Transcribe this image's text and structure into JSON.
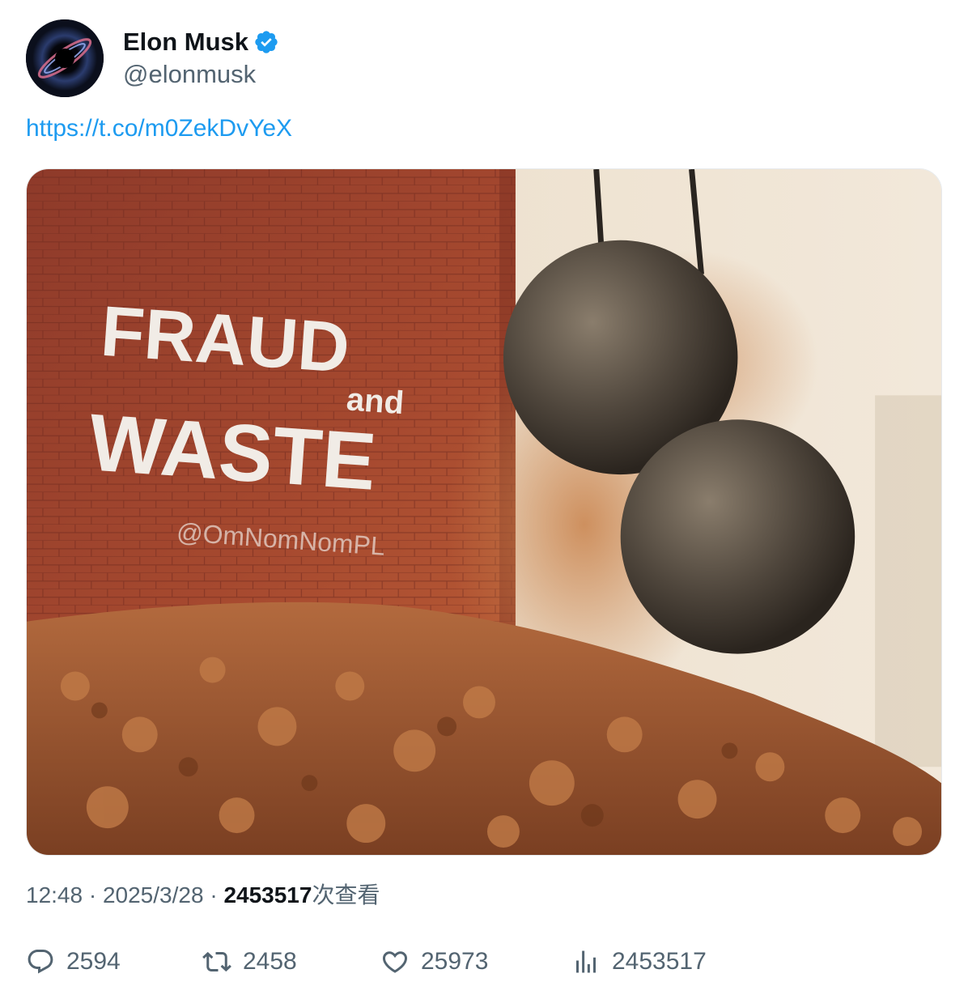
{
  "author": {
    "display_name": "Elon Musk",
    "handle": "@elonmusk",
    "verified": true,
    "avatar_icon": "black-hole-avatar",
    "verified_color": "#1d9bf0"
  },
  "tweet": {
    "link_text": "https://t.co/m0ZekDvYeX",
    "image": {
      "wall_text_line1": "FRAUD",
      "wall_text_and": "and",
      "wall_text_line2": "WASTE",
      "watermark": "@OmNomNomPL"
    }
  },
  "meta": {
    "time": "12:48",
    "separator": " · ",
    "date": "2025/3/28",
    "views_count": "2453517",
    "views_label": "次查看"
  },
  "actions": {
    "reply": {
      "icon": "reply-icon",
      "count": "2594"
    },
    "retweet": {
      "icon": "retweet-icon",
      "count": "2458"
    },
    "like": {
      "icon": "heart-icon",
      "count": "25973"
    },
    "views": {
      "icon": "analytics-icon",
      "count": "2453517"
    }
  },
  "colors": {
    "link": "#1d9bf0",
    "secondary_text": "#536471",
    "primary_text": "#0f1419",
    "wall_brick": "#a8452f",
    "rubble": "#b0653a"
  }
}
